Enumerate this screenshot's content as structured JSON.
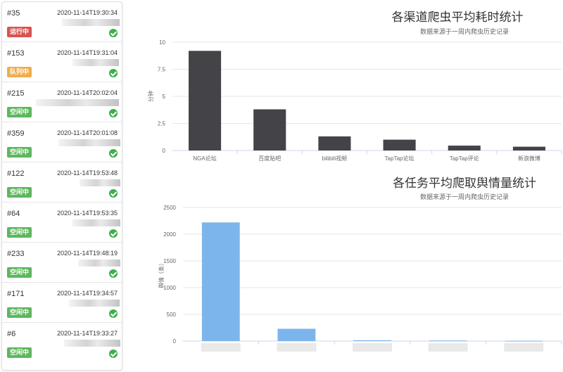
{
  "tasks": [
    {
      "id": "#35",
      "time": "2020-11-14T19:30:34",
      "status": "运行中",
      "status_type": "running"
    },
    {
      "id": "#153",
      "time": "2020-11-14T19:31:04",
      "status": "队列中",
      "status_type": "queued"
    },
    {
      "id": "#215",
      "time": "2020-11-14T20:02:04",
      "status": "空闲中",
      "status_type": "idle"
    },
    {
      "id": "#359",
      "time": "2020-11-14T20:01:08",
      "status": "空闲中",
      "status_type": "idle"
    },
    {
      "id": "#122",
      "time": "2020-11-14T19:53:48",
      "status": "空闲中",
      "status_type": "idle"
    },
    {
      "id": "#64",
      "time": "2020-11-14T19:53:35",
      "status": "空闲中",
      "status_type": "idle"
    },
    {
      "id": "#233",
      "time": "2020-11-14T19:48:19",
      "status": "空闲中",
      "status_type": "idle"
    },
    {
      "id": "#171",
      "time": "2020-11-14T19:34:57",
      "status": "空闲中",
      "status_type": "idle"
    },
    {
      "id": "#6",
      "time": "2020-11-14T19:33:27",
      "status": "空闲中",
      "status_type": "idle"
    }
  ],
  "colors": {
    "running": "#d9534f",
    "queued": "#f0ad4e",
    "idle": "#5cb85c",
    "check": "#3cb04a",
    "bar_dark": "#434348",
    "bar_blue": "#7cb5ec"
  },
  "chart_data": [
    {
      "type": "bar",
      "title": "各渠道爬虫平均耗时统计",
      "subtitle": "数据来源于一周内爬虫历史记录",
      "ylabel": "分钟",
      "categories": [
        "NGA论坛",
        "百度贴吧",
        "bilibili视频",
        "TapTap论坛",
        "TapTap评论",
        "新浪微博"
      ],
      "values": [
        9.2,
        3.8,
        1.3,
        1.0,
        0.45,
        0.35
      ],
      "ylim": [
        0,
        10
      ],
      "yticks": [
        "0",
        "2.5",
        "5",
        "7.5",
        "10"
      ],
      "color": "#434348"
    },
    {
      "type": "bar",
      "title": "各任务平均爬取舆情量统计",
      "subtitle": "数据来源于一周内爬虫历史记录",
      "ylabel": "舆情（条）",
      "categories": [
        "",
        "",
        "",
        "",
        ""
      ],
      "values": [
        2220,
        230,
        15,
        10,
        5
      ],
      "ylim": [
        0,
        2500
      ],
      "yticks": [
        "0",
        "500",
        "1000",
        "1500",
        "2000",
        "2500"
      ],
      "color": "#7cb5ec"
    }
  ]
}
